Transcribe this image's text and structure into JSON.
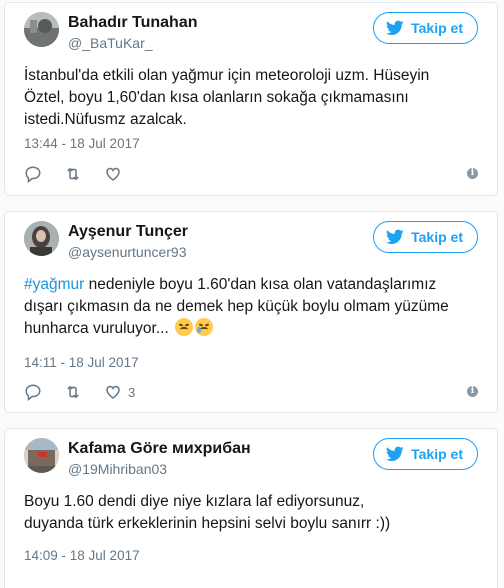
{
  "tweets": [
    {
      "name": "Bahadır Tunahan",
      "handle": "@_BaTuKar_",
      "follow_label": "Takip et",
      "text_lines": [
        "İstanbul'da etkili olan yağmur için meteoroloji uzm. Hüseyin",
        "Öztel, boyu 1,60'dan kısa olanların sokağa çıkmamasını",
        "istedi.Nüfusmz azalcak."
      ],
      "timestamp": "13:44 - 18 Jul 2017",
      "like_count": "",
      "info_glyph": "i"
    },
    {
      "name": "Ayşenur Tunçer",
      "handle": "@aysenurtuncer93",
      "follow_label": "Takip et",
      "hashtag": "#yağmur",
      "text_line1_rest": " nedeniyle boyu 1.60'dan kısa olan vatandaşlarımız",
      "text_line2": "dışarı çıkmasın da ne demek hep küçük boylu olmam yüzüme",
      "text_line3": "hunharca vuruluyor...",
      "emojis": [
        "persevering-face-icon",
        "crying-face-icon"
      ],
      "timestamp": "14:11 - 18 Jul 2017",
      "like_count": "3",
      "info_glyph": "i"
    },
    {
      "name": "Kafama Göre михрибан",
      "handle": "@19Mihriban03",
      "follow_label": "Takip et",
      "text_lines": [
        "Boyu 1.60 dendi diye niye kızlara laf ediyorsunuz,",
        "duyanda türk erkeklerinin hepsini selvi boylu sanırr :))"
      ],
      "timestamp": "14:09 - 18 Jul 2017"
    }
  ],
  "colors": {
    "accent": "#1da1f2",
    "hashtag": "#1b95e0",
    "secondary_text": "#657786",
    "border": "#e1e8ed"
  },
  "icons": {
    "follow": "twitter-bird-icon",
    "reply": "reply-icon",
    "retweet": "retweet-icon",
    "like": "heart-icon",
    "info": "info-icon"
  }
}
